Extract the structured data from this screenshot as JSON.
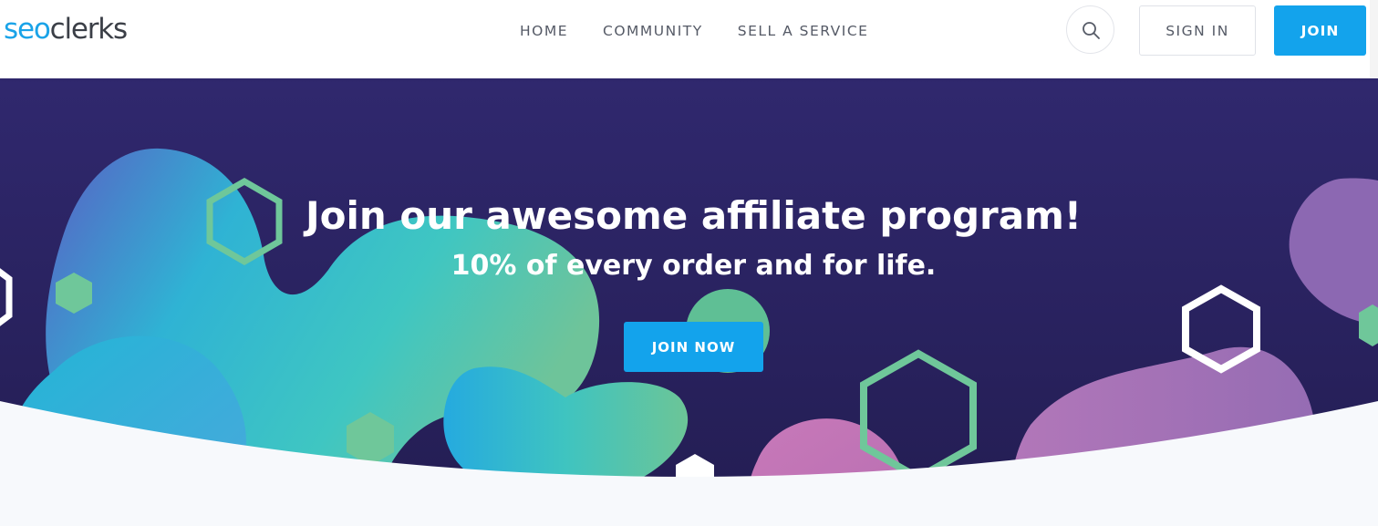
{
  "header": {
    "logo": {
      "part1": "seo",
      "part2": "clerks"
    },
    "nav": [
      {
        "label": "HOME"
      },
      {
        "label": "COMMUNITY"
      },
      {
        "label": "SELL A SERVICE"
      }
    ],
    "search_icon": "search-icon",
    "sign_in_label": "SIGN IN",
    "join_label": "JOIN"
  },
  "hero": {
    "title": "Join our awesome affiliate program!",
    "subtitle": "10% of every order and for life.",
    "cta_label": "JOIN NOW"
  },
  "colors": {
    "brand_blue": "#13a3ec",
    "hero_background": "#2b2363",
    "page_background": "#f7f9fc",
    "hexagon_green": "#6bc497",
    "blob_purple": "#9b6bb5"
  }
}
